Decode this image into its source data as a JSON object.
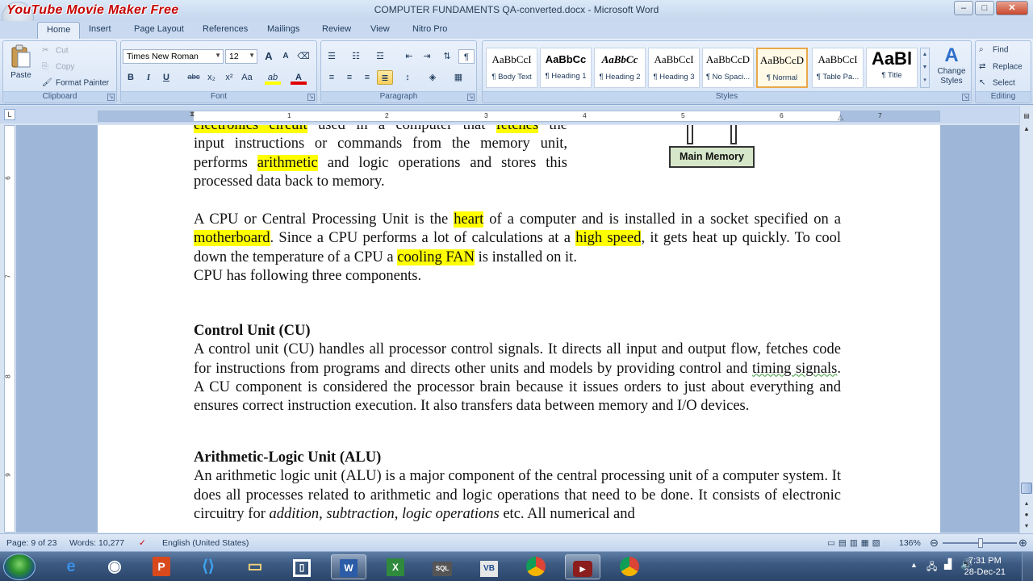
{
  "window": {
    "title": "COMPUTER FUNDAMENTS QA-converted.docx - Microsoft Word",
    "watermark": "YouTube Movie Maker Free",
    "controls": [
      "–",
      "□",
      "✕"
    ]
  },
  "tabs": [
    "Home",
    "Insert",
    "Page Layout",
    "References",
    "Mailings",
    "Review",
    "View",
    "Nitro Pro"
  ],
  "active_tab": "Home",
  "ribbon": {
    "clipboard": {
      "label": "Clipboard",
      "paste": "Paste",
      "cut": "Cut",
      "copy": "Copy",
      "format_painter": "Format Painter"
    },
    "font": {
      "label": "Font",
      "font_name": "Times New Roman",
      "font_size": "12",
      "grow": "A",
      "shrink": "A",
      "bold": "B",
      "italic": "I",
      "underline": "U",
      "strike": "abc",
      "subscript": "x₂",
      "superscript": "x²",
      "change_case": "Aa",
      "highlight": "ab",
      "font_color": "A"
    },
    "paragraph": {
      "label": "Paragraph",
      "pilcrow": "¶"
    },
    "styles": {
      "label": "Styles",
      "items": [
        {
          "sample": "AaBbCcI",
          "name": "¶ Body Text"
        },
        {
          "sample": "AaBbCc",
          "name": "¶ Heading 1"
        },
        {
          "sample": "AaBbCc",
          "name": "¶ Heading 2"
        },
        {
          "sample": "AaBbCcI",
          "name": "¶ Heading 3"
        },
        {
          "sample": "AaBbCcD",
          "name": "¶ No Spaci..."
        },
        {
          "sample": "AaBbCcD",
          "name": "¶ Normal"
        },
        {
          "sample": "AaBbCcI",
          "name": "¶ Table Pa..."
        },
        {
          "sample": "AaBl",
          "name": "¶ Title"
        }
      ],
      "selected": "¶ Normal",
      "change_styles": "Change Styles"
    },
    "editing": {
      "label": "Editing",
      "find": "Find",
      "replace": "Replace",
      "select": "Select"
    }
  },
  "ruler": {
    "corner": "L",
    "h_numbers": [
      "1",
      "2",
      "3",
      "4",
      "5",
      "6",
      "7"
    ],
    "v_numbers": [
      "6",
      "7",
      "8",
      "9"
    ]
  },
  "document": {
    "intro_lines": [
      [
        {
          "t": "electronics circuit",
          "hl": true
        },
        {
          "t": " used in a computer that ",
          "hl": false
        },
        {
          "t": "fetches",
          "hl": true
        },
        {
          "t": " the",
          "hl": false
        }
      ],
      [
        {
          "t": "input instructions or commands from the memory unit,",
          "hl": false
        }
      ],
      [
        {
          "t": "performs ",
          "hl": false
        },
        {
          "t": "arithmetic",
          "hl": true
        },
        {
          "t": " and logic operations and stores this",
          "hl": false
        }
      ],
      [
        {
          "t": "processed data back to memory.",
          "hl": false
        }
      ]
    ],
    "diagram_label": "Main Memory",
    "para2": [
      {
        "t": "A CPU or Central Processing Unit is the ",
        "hl": false
      },
      {
        "t": "heart",
        "hl": true
      },
      {
        "t": " of a computer and is installed in a socket specified on a ",
        "hl": false
      },
      {
        "t": "motherboard",
        "hl": true
      },
      {
        "t": ". Since a CPU performs a lot of calculations at a ",
        "hl": false
      },
      {
        "t": "high speed",
        "hl": true
      },
      {
        "t": ", it gets heat up quickly. To cool down the temperature of a CPU a ",
        "hl": false
      },
      {
        "t": "cooling FAN",
        "hl": true
      },
      {
        "t": " is installed on it.",
        "hl": false
      }
    ],
    "para3": "CPU has following three components.",
    "cu_heading": "Control Unit (CU)",
    "cu_a": "A control unit (CU) handles all processor control signals. It directs all input and output flow, fetches code for instructions from programs and directs other units and models by providing control and ",
    "cu_squiggle": "timing  signals",
    "cu_b": ". A CU component is considered the processor brain because it issues orders to just about everything and ensures correct instruction execution. It also transfers data between memory and I/O devices.",
    "alu_heading": "Arithmetic-Logic Unit (ALU)",
    "alu_a": "An arithmetic logic unit (ALU) is a major component of the central processing unit of a computer system. It does all processes related to arithmetic and logic operations that need to be done. It consists of electronic circuitry for ",
    "alu_i1": "addition",
    "alu_sep1": ", ",
    "alu_i2": "subtraction",
    "alu_sep2": ", ",
    "alu_i3": "logic operations",
    "alu_b": " etc. All numerical and"
  },
  "statusbar": {
    "page": "Page: 9 of 23",
    "words": "Words: 10,277",
    "language": "English (United States)",
    "zoom": "136%"
  },
  "taskbar": {
    "time": "7:31 PM",
    "date": "28-Dec-21"
  },
  "colors": {
    "highlight": "#ffff00",
    "diagram_fill": "#d6e6c9"
  }
}
